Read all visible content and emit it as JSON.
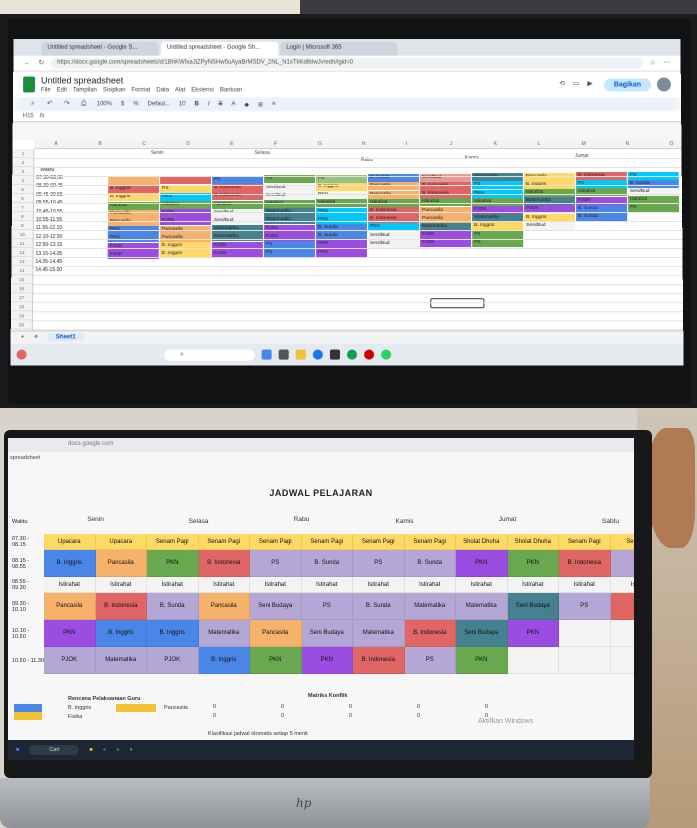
{
  "browser": {
    "tabs": [
      "Untitled spreadsheet - Google S...",
      "Untitled spreadsheet - Google Sh...",
      "Login | Microsoft 365"
    ],
    "url": "https://docs.google.com/spreadsheets/d/1BhKWIxaJlZPyNSHw5uAyaBrMSDV_2NL_N1xTkKd6tIwJv/edit#gid=0"
  },
  "sheet": {
    "title": "Untitled spreadsheet",
    "menus": [
      "File",
      "Edit",
      "Tampilan",
      "Sisipkan",
      "Format",
      "Data",
      "Alat",
      "Ekstensi",
      "Bantuan"
    ],
    "share_label": "Bagikan",
    "zoom": "100%",
    "font": "Defaul...",
    "font_size": "10",
    "cell_ref": "H15",
    "sheet_tab": "Sheet1",
    "col_letters": [
      "A",
      "B",
      "C",
      "D",
      "E",
      "F",
      "G",
      "H",
      "I",
      "J",
      "K",
      "L",
      "M",
      "N",
      "O"
    ],
    "days": [
      "Senin",
      "Selasa",
      "Rabu",
      "Kamis",
      "Jumat"
    ],
    "waktu_label": "Waktu",
    "times": [
      "07.30-08.30",
      "08.30-09.45",
      "09.45-09.55",
      "09.55-10.45",
      "10.45-10.55",
      "10.55-11.55",
      "11.55-12.10",
      "12.10-12.50",
      "12.50-13.15",
      "13.15-14.05",
      "14.05-14.45",
      "14.45-15.00"
    ],
    "row_numbers": [
      "1",
      "2",
      "3",
      "4",
      "5",
      "6",
      "7",
      "8",
      "9",
      "10",
      "11",
      "12",
      "13",
      "14",
      "15",
      "16",
      "17",
      "18",
      "19",
      "20"
    ],
    "cells": [
      {
        "r": 0,
        "c": 0,
        "t": "",
        "k": "orange"
      },
      {
        "r": 0,
        "c": 1,
        "t": "",
        "k": "red"
      },
      {
        "r": 0,
        "c": 2,
        "t": "PS",
        "k": "blue"
      },
      {
        "r": 0,
        "c": 3,
        "t": "PS",
        "k": "green"
      },
      {
        "r": 0,
        "c": 4,
        "t": "PS",
        "k": "lime"
      },
      {
        "r": 0,
        "c": 5,
        "t": "B. Sunda",
        "k": "blue"
      },
      {
        "r": 0,
        "c": 6,
        "t": "Seni/Bud",
        "k": "pink"
      },
      {
        "r": 0,
        "c": 7,
        "t": "Matematika",
        "k": "teal"
      },
      {
        "r": 0,
        "c": 8,
        "t": "Pancasila",
        "k": "yellow"
      },
      {
        "r": 0,
        "c": 9,
        "t": "B. Indonesia",
        "k": "red"
      },
      {
        "r": 0,
        "c": 10,
        "t": "PS",
        "k": "cyan"
      },
      {
        "r": 1,
        "c": 0,
        "t": "B. Inggris",
        "k": "red"
      },
      {
        "r": 1,
        "c": 1,
        "t": "PS",
        "k": "yellow"
      },
      {
        "r": 1,
        "c": 2,
        "t": "B. Indonesia",
        "k": "red"
      },
      {
        "r": 1,
        "c": 3,
        "t": "Seni/Bud",
        "k": "white"
      },
      {
        "r": 1,
        "c": 4,
        "t": "B. Inggris",
        "k": "yellow"
      },
      {
        "r": 1,
        "c": 5,
        "t": "Pancasila",
        "k": "orange"
      },
      {
        "r": 1,
        "c": 6,
        "t": "B. Indonesia",
        "k": "red"
      },
      {
        "r": 1,
        "c": 7,
        "t": "PS",
        "k": "cyan"
      },
      {
        "r": 1,
        "c": 8,
        "t": "B. Inggris",
        "k": "yellow"
      },
      {
        "r": 1,
        "c": 9,
        "t": "PS",
        "k": "cyan"
      },
      {
        "r": 1,
        "c": 10,
        "t": "B. Sunda",
        "k": "blue"
      },
      {
        "r": 2,
        "c": 0,
        "t": "B. Inggris",
        "k": "yellow"
      },
      {
        "r": 2,
        "c": 1,
        "t": "PKN",
        "k": "cyan"
      },
      {
        "r": 2,
        "c": 2,
        "t": "B. Indonesia",
        "k": "red"
      },
      {
        "r": 2,
        "c": 3,
        "t": "Seni/Bud",
        "k": "white"
      },
      {
        "r": 2,
        "c": 4,
        "t": "PKN",
        "k": "white"
      },
      {
        "r": 2,
        "c": 5,
        "t": "Pancasila",
        "k": "orange"
      },
      {
        "r": 2,
        "c": 6,
        "t": "B. Indonesia",
        "k": "red"
      },
      {
        "r": 2,
        "c": 7,
        "t": "PKN",
        "k": "cyan"
      },
      {
        "r": 2,
        "c": 8,
        "t": "Istirahat",
        "k": "green"
      },
      {
        "r": 2,
        "c": 9,
        "t": "Istirahat",
        "k": "green"
      },
      {
        "r": 2,
        "c": 10,
        "t": "Seni/Bud",
        "k": "white"
      },
      {
        "r": 3,
        "c": 0,
        "t": "Istirahat",
        "k": "green"
      },
      {
        "r": 3,
        "c": 1,
        "t": "Istirahat",
        "k": "green"
      },
      {
        "r": 3,
        "c": 2,
        "t": "Istirahat",
        "k": "green"
      },
      {
        "r": 3,
        "c": 3,
        "t": "Istirahat",
        "k": "green"
      },
      {
        "r": 3,
        "c": 4,
        "t": "Istirahat",
        "k": "green"
      },
      {
        "r": 3,
        "c": 5,
        "t": "Istirahat",
        "k": "green"
      },
      {
        "r": 3,
        "c": 6,
        "t": "Istirahat",
        "k": "green"
      },
      {
        "r": 3,
        "c": 7,
        "t": "Istirahat",
        "k": "green"
      },
      {
        "r": 3,
        "c": 8,
        "t": "Matematika",
        "k": "teal"
      },
      {
        "r": 3,
        "c": 9,
        "t": "PJOK",
        "k": "purple"
      },
      {
        "r": 3,
        "c": 10,
        "t": "Istirahat",
        "k": "green"
      },
      {
        "r": 4,
        "c": 0,
        "t": "Pancasila",
        "k": "orange"
      },
      {
        "r": 4,
        "c": 1,
        "t": "PJOK",
        "k": "purple"
      },
      {
        "r": 4,
        "c": 2,
        "t": "Seni/Bud",
        "k": "white"
      },
      {
        "r": 4,
        "c": 3,
        "t": "Matematika",
        "k": "teal"
      },
      {
        "r": 4,
        "c": 4,
        "t": "PKN",
        "k": "cyan"
      },
      {
        "r": 4,
        "c": 5,
        "t": "B. Indonesia",
        "k": "red"
      },
      {
        "r": 4,
        "c": 6,
        "t": "Pancasila",
        "k": "orange"
      },
      {
        "r": 4,
        "c": 7,
        "t": "PJOK",
        "k": "purple"
      },
      {
        "r": 4,
        "c": 8,
        "t": "PJOK",
        "k": "purple"
      },
      {
        "r": 4,
        "c": 9,
        "t": "B. Sunda",
        "k": "blue"
      },
      {
        "r": 4,
        "c": 10,
        "t": "PS",
        "k": "green"
      },
      {
        "r": 5,
        "c": 0,
        "t": "Pancasila",
        "k": "orange"
      },
      {
        "r": 5,
        "c": 1,
        "t": "PJOK",
        "k": "purple"
      },
      {
        "r": 5,
        "c": 2,
        "t": "Seni/Bud",
        "k": "white"
      },
      {
        "r": 5,
        "c": 3,
        "t": "Matematika",
        "k": "teal"
      },
      {
        "r": 5,
        "c": 4,
        "t": "PKN",
        "k": "cyan"
      },
      {
        "r": 5,
        "c": 5,
        "t": "B. Indonesia",
        "k": "red"
      },
      {
        "r": 5,
        "c": 6,
        "t": "Pancasila",
        "k": "orange"
      },
      {
        "r": 5,
        "c": 7,
        "t": "Matematika",
        "k": "teal"
      },
      {
        "r": 5,
        "c": 8,
        "t": "B. Inggris",
        "k": "yellow"
      },
      {
        "r": 5,
        "c": 9,
        "t": "B. Sunda",
        "k": "blue"
      },
      {
        "r": 6,
        "c": 0,
        "t": "PKN",
        "k": "blue"
      },
      {
        "r": 6,
        "c": 1,
        "t": "Pancasila",
        "k": "orange"
      },
      {
        "r": 6,
        "c": 2,
        "t": "Matematika",
        "k": "teal"
      },
      {
        "r": 6,
        "c": 3,
        "t": "PJOK",
        "k": "purple"
      },
      {
        "r": 6,
        "c": 4,
        "t": "B. Sunda",
        "k": "blue"
      },
      {
        "r": 6,
        "c": 5,
        "t": "PKN",
        "k": "cyan"
      },
      {
        "r": 6,
        "c": 6,
        "t": "Matematika",
        "k": "teal"
      },
      {
        "r": 6,
        "c": 7,
        "t": "B. Inggris",
        "k": "yellow"
      },
      {
        "r": 6,
        "c": 8,
        "t": "Seni/Bud",
        "k": "white"
      },
      {
        "r": 7,
        "c": 0,
        "t": "PKN",
        "k": "blue"
      },
      {
        "r": 7,
        "c": 1,
        "t": "Pancasila",
        "k": "orange"
      },
      {
        "r": 7,
        "c": 2,
        "t": "Matematika",
        "k": "teal"
      },
      {
        "r": 7,
        "c": 3,
        "t": "PJOK",
        "k": "purple"
      },
      {
        "r": 7,
        "c": 4,
        "t": "B. Sunda",
        "k": "blue"
      },
      {
        "r": 7,
        "c": 5,
        "t": "Seni/Bud",
        "k": "white"
      },
      {
        "r": 7,
        "c": 6,
        "t": "PJOK",
        "k": "purple"
      },
      {
        "r": 7,
        "c": 7,
        "t": "PS",
        "k": "green"
      },
      {
        "r": 8,
        "c": 0,
        "t": "PJOK",
        "k": "purple"
      },
      {
        "r": 8,
        "c": 1,
        "t": "B. Inggris",
        "k": "yellow"
      },
      {
        "r": 8,
        "c": 2,
        "t": "PJOK",
        "k": "purple"
      },
      {
        "r": 8,
        "c": 3,
        "t": "PS",
        "k": "blue"
      },
      {
        "r": 8,
        "c": 4,
        "t": "PKN",
        "k": "purple"
      },
      {
        "r": 8,
        "c": 5,
        "t": "Seni/Bud",
        "k": "white"
      },
      {
        "r": 8,
        "c": 6,
        "t": "PJOK",
        "k": "purple"
      },
      {
        "r": 8,
        "c": 7,
        "t": "PS",
        "k": "green"
      },
      {
        "r": 9,
        "c": 0,
        "t": "PJOK",
        "k": "purple"
      },
      {
        "r": 9,
        "c": 1,
        "t": "B. Inggris",
        "k": "yellow"
      },
      {
        "r": 9,
        "c": 2,
        "t": "PJOK",
        "k": "purple"
      },
      {
        "r": 9,
        "c": 3,
        "t": "PS",
        "k": "blue"
      },
      {
        "r": 9,
        "c": 4,
        "t": "PKN",
        "k": "purple"
      }
    ]
  },
  "laptop": {
    "url": "docs.google.com",
    "doc_title": "spreadsheet",
    "heading": "JADWAL PELAJARAN",
    "days": [
      "Senin",
      "Selasa",
      "Rabu",
      "Kamis",
      "Jumat",
      "Sabtu"
    ],
    "waktu_label": "Waktu",
    "rows": [
      {
        "time": "07.30 - 08.15",
        "cells": [
          [
            "Upacara",
            "yellow"
          ],
          [
            "Upacara",
            "yellow"
          ],
          [
            "Senam Pagi",
            "yellow"
          ],
          [
            "Senam Pagi",
            "yellow"
          ],
          [
            "Senam Pagi",
            "yellow"
          ],
          [
            "Senam Pagi",
            "yellow"
          ],
          [
            "Senam Pagi",
            "yellow"
          ],
          [
            "Senam Pagi",
            "yellow"
          ],
          [
            "Sholat Dhuha",
            "yellow"
          ],
          [
            "Sholat Dhuha",
            "yellow"
          ],
          [
            "Senam Pagi",
            "yellow"
          ],
          [
            "Senam",
            "yellow"
          ]
        ]
      },
      {
        "time": "08.15 - 08.55",
        "cells": [
          [
            "B. Inggris",
            "blue"
          ],
          [
            "Pancasila",
            "orange"
          ],
          [
            "PKN",
            "green"
          ],
          [
            "B. Indonesia",
            "red"
          ],
          [
            "PS",
            "lavender"
          ],
          [
            "B. Sunda",
            "lavender"
          ],
          [
            "PS",
            "lavender"
          ],
          [
            "B. Sunda",
            "lavender"
          ],
          [
            "PKN",
            "purple"
          ],
          [
            "PKN",
            "green"
          ],
          [
            "B. Indonesia",
            "red"
          ],
          [
            "",
            "lavender"
          ]
        ]
      },
      {
        "time": "08.55 - 09.30",
        "cells": [
          [
            "Istirahat",
            "white"
          ],
          [
            "Istirahat",
            "white"
          ],
          [
            "Istirahat",
            "white"
          ],
          [
            "Istirahat",
            "white"
          ],
          [
            "Istirahat",
            "white"
          ],
          [
            "Istirahat",
            "white"
          ],
          [
            "Istirahat",
            "white"
          ],
          [
            "Istirahat",
            "white"
          ],
          [
            "Istirahat",
            "white"
          ],
          [
            "Istirahat",
            "white"
          ],
          [
            "Istirahat",
            "white"
          ],
          [
            "Istir",
            "white"
          ]
        ]
      },
      {
        "time": "09.30 - 10.10",
        "cells": [
          [
            "Pancasila",
            "orange"
          ],
          [
            "B. Indonesia",
            "red"
          ],
          [
            "B. Sunda",
            "lavender"
          ],
          [
            "Pancasila",
            "orange"
          ],
          [
            "Seni Budaya",
            "lavender"
          ],
          [
            "PS",
            "lavender"
          ],
          [
            "B. Sunda",
            "lavender"
          ],
          [
            "Matematika",
            "lavender"
          ],
          [
            "Matematika",
            "lavender"
          ],
          [
            "Seni Budaya",
            "teal"
          ],
          [
            "PS",
            "lavender"
          ],
          [
            "",
            "red"
          ]
        ]
      },
      {
        "time": "10.10 - 10.50",
        "cells": [
          [
            "PKN",
            "purple"
          ],
          [
            "B. Inggris",
            "blue"
          ],
          [
            "B. Inggris",
            "blue"
          ],
          [
            "Matematika",
            "lavender"
          ],
          [
            "Pancasila",
            "orange"
          ],
          [
            "Seni Budaya",
            "lavender"
          ],
          [
            "Matematika",
            "lavender"
          ],
          [
            "B. Indonesia",
            "red"
          ],
          [
            "Seni Budaya",
            "teal"
          ],
          [
            "PKN",
            "purple"
          ],
          [
            "",
            "white"
          ],
          [
            "",
            "white"
          ]
        ]
      },
      {
        "time": "10.50 - 11.30",
        "cells": [
          [
            "PJOK",
            "lavender"
          ],
          [
            "Matematika",
            "lavender"
          ],
          [
            "PJOK",
            "lavender"
          ],
          [
            "B. Inggris",
            "blue"
          ],
          [
            "PKN",
            "green"
          ],
          [
            "PKN",
            "purple"
          ],
          [
            "B. Indonesia",
            "red"
          ],
          [
            "PS",
            "lavender"
          ],
          [
            "PKN",
            "green"
          ],
          [
            "",
            "white"
          ],
          [
            "",
            "white"
          ],
          [
            "",
            "white"
          ]
        ]
      }
    ],
    "legend_title": "Rencana Pelaksanaan Guru",
    "legend_items": [
      "B. Inggris",
      "Pancasila",
      "Fisika"
    ],
    "matrix_title": "Matriks Konflik",
    "matrix_rows": [
      [
        "0",
        "0",
        "0",
        "0",
        "0"
      ],
      [
        "0",
        "0",
        "0",
        "0",
        "0"
      ]
    ],
    "footer_text": "Klasifikasi jadwal otomatis setiap 5 menit",
    "search": "Cari",
    "activate": "Aktifkan Windows"
  },
  "colors": {
    "orange": "#f6b26b",
    "red": "#e06666",
    "blue": "#4a86e8",
    "green": "#6aa84f",
    "lime": "#93c47d",
    "teal": "#45818e",
    "yellow": "#ffd966",
    "cyan": "#00c8ff",
    "purple": "#9a4de0",
    "pink": "#ea9999",
    "white": "#f3f3f3",
    "lavender": "#b4a7d6"
  }
}
